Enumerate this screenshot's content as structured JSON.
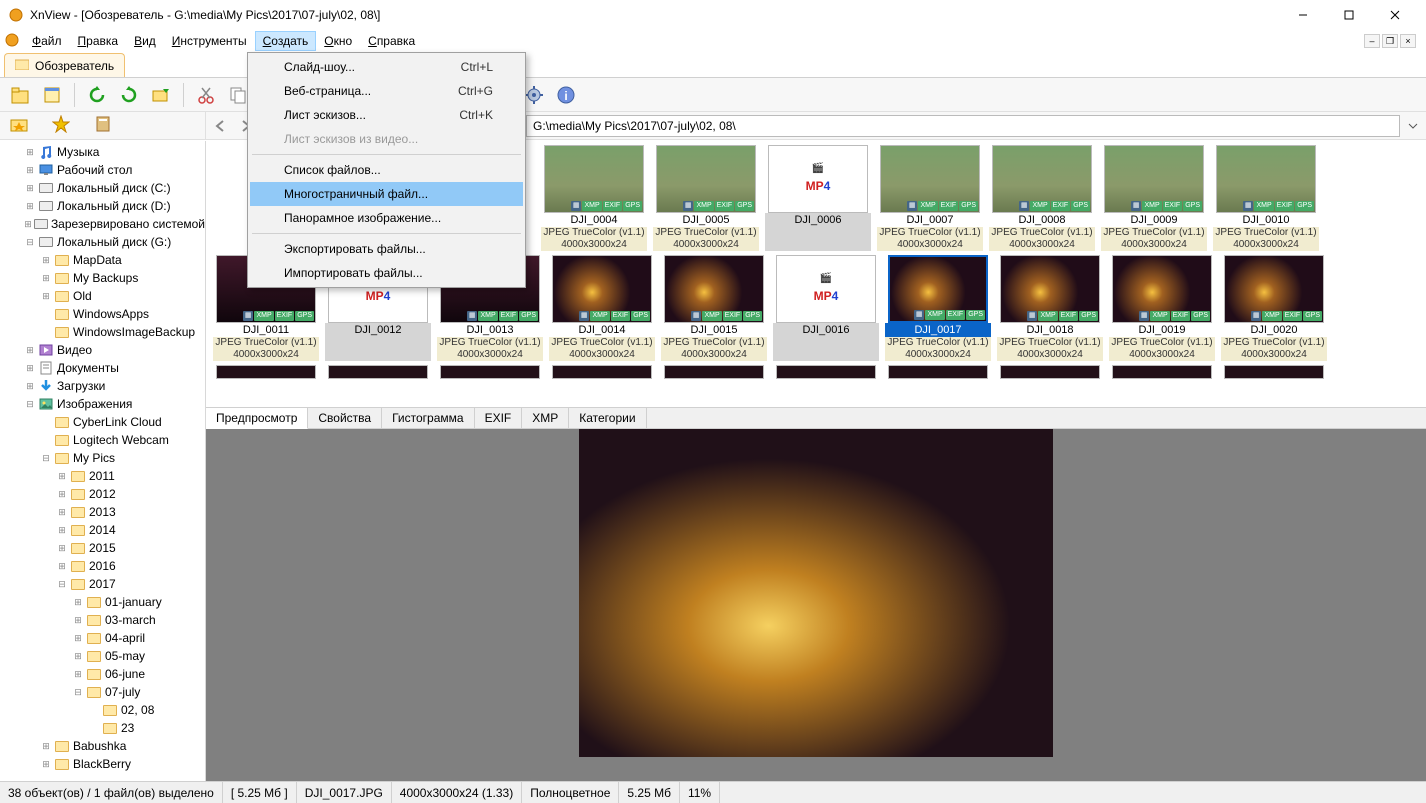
{
  "window": {
    "title": "XnView - [Обозреватель - G:\\media\\My Pics\\2017\\07-july\\02, 08\\]"
  },
  "menubar": {
    "items": [
      "Файл",
      "Правка",
      "Вид",
      "Инструменты",
      "Создать",
      "Окно",
      "Справка"
    ],
    "active_index": 4
  },
  "doctab": {
    "label": "Обозреватель"
  },
  "path": {
    "value": "G:\\media\\My Pics\\2017\\07-july\\02, 08\\"
  },
  "dropdown": {
    "items": [
      {
        "label": "Слайд-шоу...",
        "shortcut": "Ctrl+L"
      },
      {
        "label": "Веб-страница...",
        "shortcut": "Ctrl+G"
      },
      {
        "label": "Лист эскизов...",
        "shortcut": "Ctrl+K"
      },
      {
        "label": "Лист эскизов из видео...",
        "disabled": true
      },
      {
        "sep": true
      },
      {
        "label": "Список файлов..."
      },
      {
        "label": "Многостраничный файл...",
        "selected": true
      },
      {
        "label": "Панорамное изображение..."
      },
      {
        "sep": true
      },
      {
        "label": "Экспортировать файлы..."
      },
      {
        "label": "Импортировать файлы..."
      }
    ]
  },
  "tree": [
    {
      "depth": 1,
      "tw": "+",
      "icon": "music",
      "label": "Музыка"
    },
    {
      "depth": 1,
      "tw": "+",
      "icon": "desktop",
      "label": "Рабочий стол"
    },
    {
      "depth": 1,
      "tw": "+",
      "icon": "drive",
      "label": "Локальный диск (C:)"
    },
    {
      "depth": 1,
      "tw": "+",
      "icon": "drive",
      "label": "Локальный диск (D:)"
    },
    {
      "depth": 1,
      "tw": "+",
      "icon": "drive",
      "label": "Зарезервировано системой"
    },
    {
      "depth": 1,
      "tw": "-",
      "icon": "drive",
      "label": "Локальный диск (G:)"
    },
    {
      "depth": 2,
      "tw": "+",
      "icon": "folder",
      "label": "MapData"
    },
    {
      "depth": 2,
      "tw": "+",
      "icon": "folder",
      "label": "My Backups"
    },
    {
      "depth": 2,
      "tw": "+",
      "icon": "folder",
      "label": "Old"
    },
    {
      "depth": 2,
      "tw": "",
      "icon": "folder",
      "label": "WindowsApps"
    },
    {
      "depth": 2,
      "tw": "",
      "icon": "folder",
      "label": "WindowsImageBackup"
    },
    {
      "depth": 1,
      "tw": "+",
      "icon": "video",
      "label": "Видео"
    },
    {
      "depth": 1,
      "tw": "+",
      "icon": "docs",
      "label": "Документы"
    },
    {
      "depth": 1,
      "tw": "+",
      "icon": "down",
      "label": "Загрузки"
    },
    {
      "depth": 1,
      "tw": "-",
      "icon": "pics",
      "label": "Изображения"
    },
    {
      "depth": 2,
      "tw": "",
      "icon": "folder",
      "label": "CyberLink Cloud"
    },
    {
      "depth": 2,
      "tw": "",
      "icon": "folder",
      "label": "Logitech Webcam"
    },
    {
      "depth": 2,
      "tw": "-",
      "icon": "folder",
      "label": "My Pics"
    },
    {
      "depth": 3,
      "tw": "+",
      "icon": "folder",
      "label": "2011"
    },
    {
      "depth": 3,
      "tw": "+",
      "icon": "folder",
      "label": "2012"
    },
    {
      "depth": 3,
      "tw": "+",
      "icon": "folder",
      "label": "2013"
    },
    {
      "depth": 3,
      "tw": "+",
      "icon": "folder",
      "label": "2014"
    },
    {
      "depth": 3,
      "tw": "+",
      "icon": "folder",
      "label": "2015"
    },
    {
      "depth": 3,
      "tw": "+",
      "icon": "folder",
      "label": "2016"
    },
    {
      "depth": 3,
      "tw": "-",
      "icon": "folder",
      "label": "2017"
    },
    {
      "depth": 4,
      "tw": "+",
      "icon": "folder",
      "label": "01-january"
    },
    {
      "depth": 4,
      "tw": "+",
      "icon": "folder",
      "label": "03-march"
    },
    {
      "depth": 4,
      "tw": "+",
      "icon": "folder",
      "label": "04-april"
    },
    {
      "depth": 4,
      "tw": "+",
      "icon": "folder",
      "label": "05-may"
    },
    {
      "depth": 4,
      "tw": "+",
      "icon": "folder",
      "label": "06-june"
    },
    {
      "depth": 4,
      "tw": "-",
      "icon": "folder",
      "label": "07-july"
    },
    {
      "depth": 5,
      "tw": "",
      "icon": "folder",
      "label": "02, 08"
    },
    {
      "depth": 5,
      "tw": "",
      "icon": "folder",
      "label": "23"
    },
    {
      "depth": 2,
      "tw": "+",
      "icon": "folder",
      "label": "Babushka"
    },
    {
      "depth": 2,
      "tw": "+",
      "icon": "folder",
      "label": "BlackBerry"
    }
  ],
  "badges_img": [
    "XMP",
    "EXIF",
    "GPS"
  ],
  "thumbs_row1": [
    {
      "name": "DJI_0004",
      "type": "img",
      "img": "sky",
      "meta1": "JPEG TrueColor (v1.1)",
      "meta2": "4000x3000x24"
    },
    {
      "name": "DJI_0005",
      "type": "img",
      "img": "sky",
      "meta1": "JPEG TrueColor (v1.1)",
      "meta2": "4000x3000x24"
    },
    {
      "name": "DJI_0006",
      "type": "mp4",
      "img": "mp4"
    },
    {
      "name": "DJI_0007",
      "type": "img",
      "img": "sky",
      "meta1": "JPEG TrueColor (v1.1)",
      "meta2": "4000x3000x24"
    },
    {
      "name": "DJI_0008",
      "type": "img",
      "img": "sky",
      "meta1": "JPEG TrueColor (v1.1)",
      "meta2": "4000x3000x24"
    },
    {
      "name": "DJI_0009",
      "type": "img",
      "img": "sky",
      "meta1": "JPEG TrueColor (v1.1)",
      "meta2": "4000x3000x24"
    },
    {
      "name": "DJI_0010",
      "type": "img",
      "img": "sky",
      "meta1": "JPEG TrueColor (v1.1)",
      "meta2": "4000x3000x24"
    }
  ],
  "thumbs_row2": [
    {
      "name": "DJI_0011",
      "type": "img",
      "img": "dusk",
      "meta1": "JPEG TrueColor (v1.1)",
      "meta2": "4000x3000x24"
    },
    {
      "name": "DJI_0012",
      "type": "mp4",
      "img": "mp4"
    },
    {
      "name": "DJI_0013",
      "type": "img",
      "img": "dusk",
      "meta1": "JPEG TrueColor (v1.1)",
      "meta2": "4000x3000x24"
    },
    {
      "name": "DJI_0014",
      "type": "img",
      "img": "night",
      "meta1": "JPEG TrueColor (v1.1)",
      "meta2": "4000x3000x24"
    },
    {
      "name": "DJI_0015",
      "type": "img",
      "img": "night",
      "meta1": "JPEG TrueColor (v1.1)",
      "meta2": "4000x3000x24"
    },
    {
      "name": "DJI_0016",
      "type": "mp4",
      "img": "mp4"
    },
    {
      "name": "DJI_0017",
      "type": "img",
      "img": "night",
      "meta1": "JPEG TrueColor (v1.1)",
      "meta2": "4000x3000x24",
      "selected": true
    },
    {
      "name": "DJI_0018",
      "type": "img",
      "img": "night",
      "meta1": "JPEG TrueColor (v1.1)",
      "meta2": "4000x3000x24"
    },
    {
      "name": "DJI_0019",
      "type": "img",
      "img": "night",
      "meta1": "JPEG TrueColor (v1.1)",
      "meta2": "4000x3000x24"
    },
    {
      "name": "DJI_0020",
      "type": "img",
      "img": "night",
      "meta1": "JPEG TrueColor (v1.1)",
      "meta2": "4000x3000x24"
    }
  ],
  "preview_tabs": [
    "Предпросмотр",
    "Свойства",
    "Гистограмма",
    "EXIF",
    "XMP",
    "Категории"
  ],
  "status": {
    "objects": "38 объект(ов) / 1 файл(ов) выделено",
    "size_sel": "[ 5.25 Мб ]",
    "filename": "DJI_0017.JPG",
    "dims": "4000x3000x24 (1.33)",
    "colormode": "Полноцветное",
    "filesize": "5.25 Мб",
    "zoom": "11%"
  }
}
